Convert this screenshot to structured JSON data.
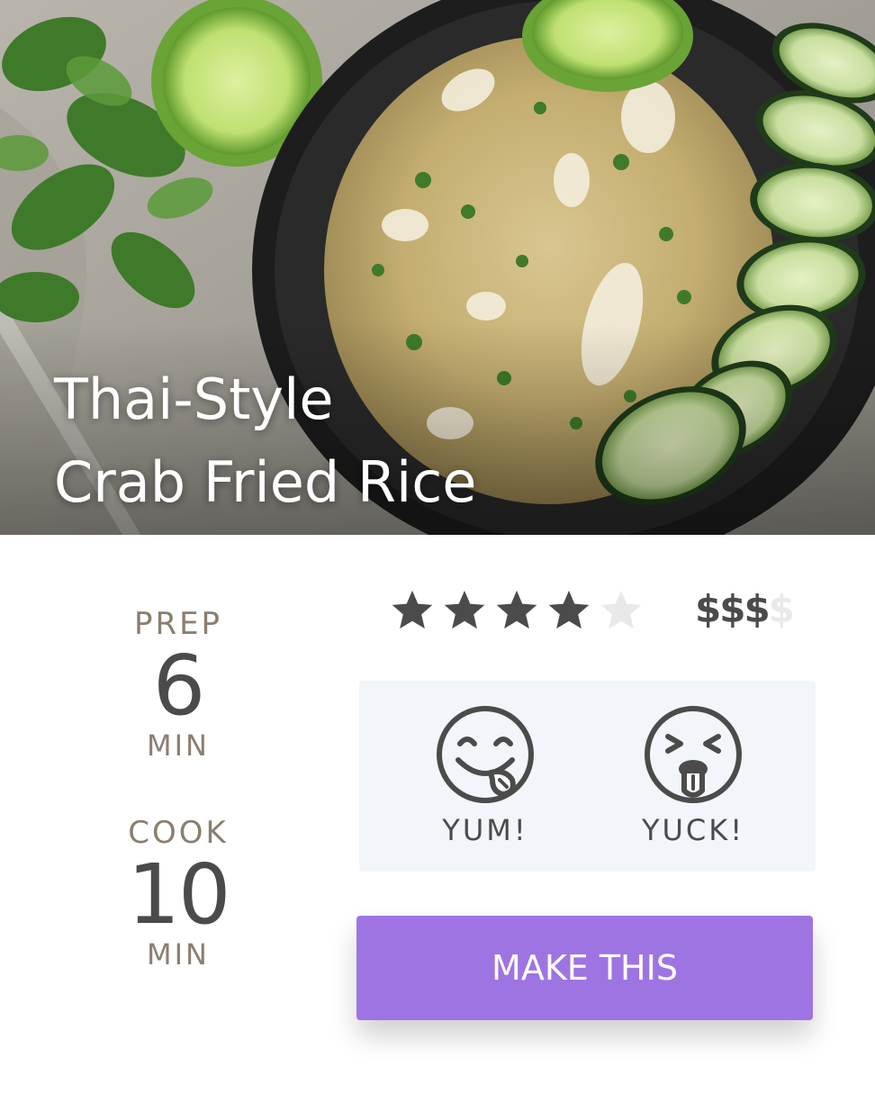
{
  "recipe": {
    "title_line1": "Thai-Style",
    "title_line2": "Crab Fried Rice"
  },
  "times": {
    "prep": {
      "label": "PREP",
      "value": "6",
      "unit": "MIN"
    },
    "cook": {
      "label": "COOK",
      "value": "10",
      "unit": "MIN"
    }
  },
  "rating": {
    "value": 4,
    "max": 5,
    "icon": "star-icon"
  },
  "price": {
    "active": "$$$",
    "inactive": "$"
  },
  "reactions": {
    "yum": {
      "label": "YUM!",
      "icon": "yum-face-icon"
    },
    "yuck": {
      "label": "YUCK!",
      "icon": "yuck-face-icon"
    }
  },
  "action": {
    "label": "MAKE THIS"
  },
  "colors": {
    "accent": "#9e74e2",
    "text_dark": "#4b4b4b",
    "text_muted": "#8c7e6e",
    "panel_bg": "#f2f5fa",
    "star_on": "#4b4b4b",
    "star_off": "#e9e9e9"
  }
}
